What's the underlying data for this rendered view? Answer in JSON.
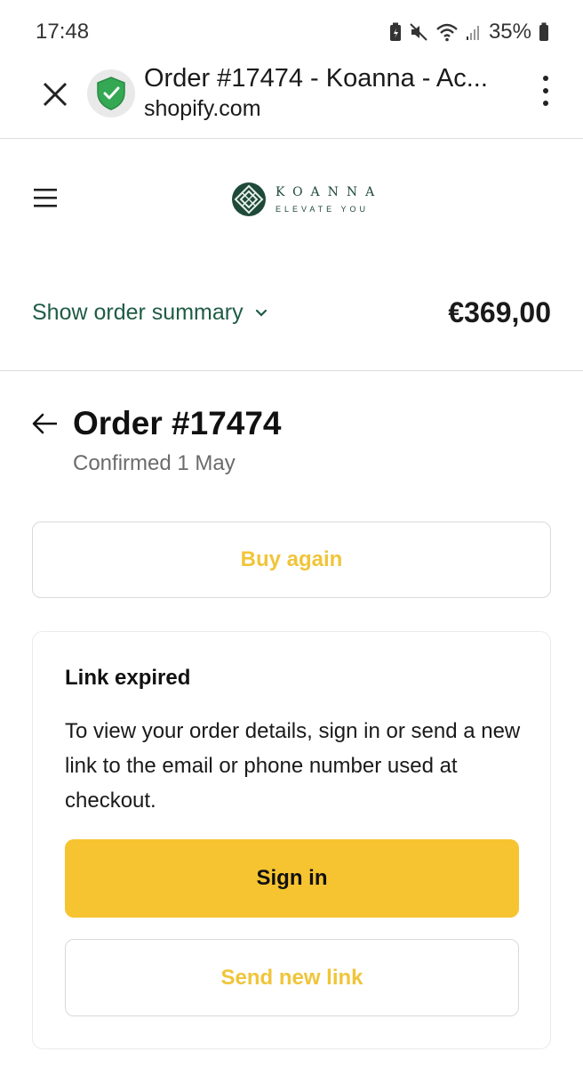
{
  "status_bar": {
    "time": "17:48",
    "battery": "35%"
  },
  "browser": {
    "title": "Order #17474 - Koanna - Ac...",
    "domain": "shopify.com",
    "icons": [
      "close-icon",
      "shield-check-icon",
      "kebab-menu-icon"
    ]
  },
  "store": {
    "logo_name": "KOANNA",
    "logo_tagline": "ELEVATE YOU",
    "brand_color": "#1f4a3a"
  },
  "summary": {
    "toggle_label": "Show order summary",
    "total": "€369,00"
  },
  "order": {
    "title": "Order #17474",
    "subtitle": "Confirmed 1 May",
    "buy_again_label": "Buy again"
  },
  "card": {
    "title": "Link expired",
    "text": "To view your order details, sign in or send a new link to the email or phone number used at checkout.",
    "signin_label": "Sign in",
    "send_link_label": "Send new link"
  },
  "colors": {
    "accent": "#f6c431",
    "accent_text": "#f0c53a",
    "link_green": "#1f5c45"
  }
}
